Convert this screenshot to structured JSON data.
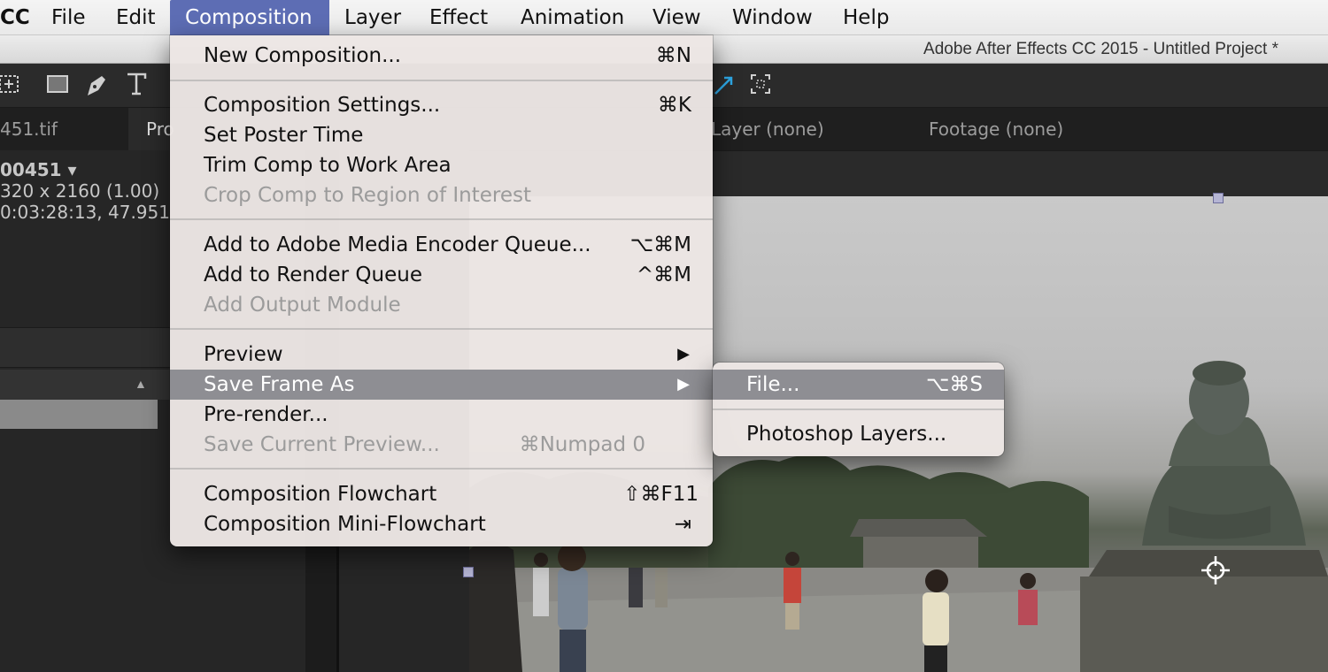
{
  "menubar": {
    "app": "CC",
    "items": [
      "File",
      "Edit",
      "Composition",
      "Layer",
      "Effect",
      "Animation",
      "View",
      "Window",
      "Help"
    ],
    "active": "Composition"
  },
  "window": {
    "title": "Adobe After Effects CC 2015 - Untitled Project *"
  },
  "tabs": {
    "left_file": "451.tif",
    "project": "Pro",
    "layer": "Layer (none)",
    "footage": "Footage (none)"
  },
  "info": {
    "name": "00451 ▾",
    "dimensions": "320 x 2160 (1.00)",
    "duration": "0:03:28:13, 47.951"
  },
  "composition_menu": {
    "items": [
      {
        "label": "New Composition...",
        "shortcut": "⌘N"
      },
      {
        "label": "Composition Settings...",
        "shortcut": "⌘K"
      },
      {
        "label": "Set Poster Time",
        "shortcut": ""
      },
      {
        "label": "Trim Comp to Work Area",
        "shortcut": ""
      },
      {
        "label": "Crop Comp to Region of Interest",
        "shortcut": ""
      },
      {
        "label": "Add to Adobe Media Encoder Queue...",
        "shortcut": "⌥⌘M"
      },
      {
        "label": "Add to Render Queue",
        "shortcut": "^⌘M"
      },
      {
        "label": "Add Output Module",
        "shortcut": ""
      },
      {
        "label": "Preview",
        "shortcut": "▶"
      },
      {
        "label": "Save Frame As",
        "shortcut": "▶"
      },
      {
        "label": "Pre-render...",
        "shortcut": ""
      },
      {
        "label": "Save Current Preview...",
        "shortcut": "⌘Numpad 0"
      },
      {
        "label": "Composition Flowchart",
        "shortcut": "⇧⌘F11"
      },
      {
        "label": "Composition Mini-Flowchart",
        "shortcut": "⇥"
      }
    ]
  },
  "save_frame_submenu": {
    "items": [
      {
        "label": "File...",
        "shortcut": "⌥⌘S"
      },
      {
        "label": "Photoshop Layers...",
        "shortcut": ""
      }
    ]
  },
  "tools": {
    "icons": [
      "selection-transform-icon",
      "rectangle-tool-icon",
      "pen-tool-icon",
      "type-tool-icon",
      "snapping-icon",
      "roi-icon"
    ]
  }
}
